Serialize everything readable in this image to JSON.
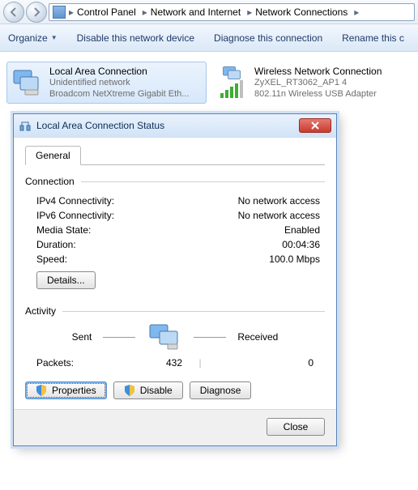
{
  "breadcrumb": {
    "items": [
      "Control Panel",
      "Network and Internet",
      "Network Connections"
    ]
  },
  "toolbar": {
    "organize": "Organize",
    "disable": "Disable this network device",
    "diagnose": "Diagnose this connection",
    "rename": "Rename this c"
  },
  "connections": [
    {
      "title": "Local Area Connection",
      "sub1": "Unidentified network",
      "sub2": "Broadcom NetXtreme Gigabit Eth...",
      "selected": true,
      "kind": "ethernet"
    },
    {
      "title": "Wireless Network Connection",
      "sub1": "ZyXEL_RT3062_AP1  4",
      "sub2": "802.11n Wireless USB Adapter",
      "selected": false,
      "kind": "wifi"
    }
  ],
  "dialog": {
    "title": "Local Area Connection Status",
    "tab_general": "General",
    "group_connection": "Connection",
    "group_activity": "Activity",
    "rows": {
      "ipv4_k": "IPv4 Connectivity:",
      "ipv4_v": "No network access",
      "ipv6_k": "IPv6 Connectivity:",
      "ipv6_v": "No network access",
      "media_k": "Media State:",
      "media_v": "Enabled",
      "dur_k": "Duration:",
      "dur_v": "00:04:36",
      "speed_k": "Speed:",
      "speed_v": "100.0 Mbps"
    },
    "details_btn": "Details...",
    "activity": {
      "sent_label": "Sent",
      "recv_label": "Received",
      "packets_label": "Packets:",
      "sent": "432",
      "recv": "0"
    },
    "buttons": {
      "properties": "Properties",
      "disable": "Disable",
      "diagnose": "Diagnose",
      "close": "Close"
    }
  }
}
